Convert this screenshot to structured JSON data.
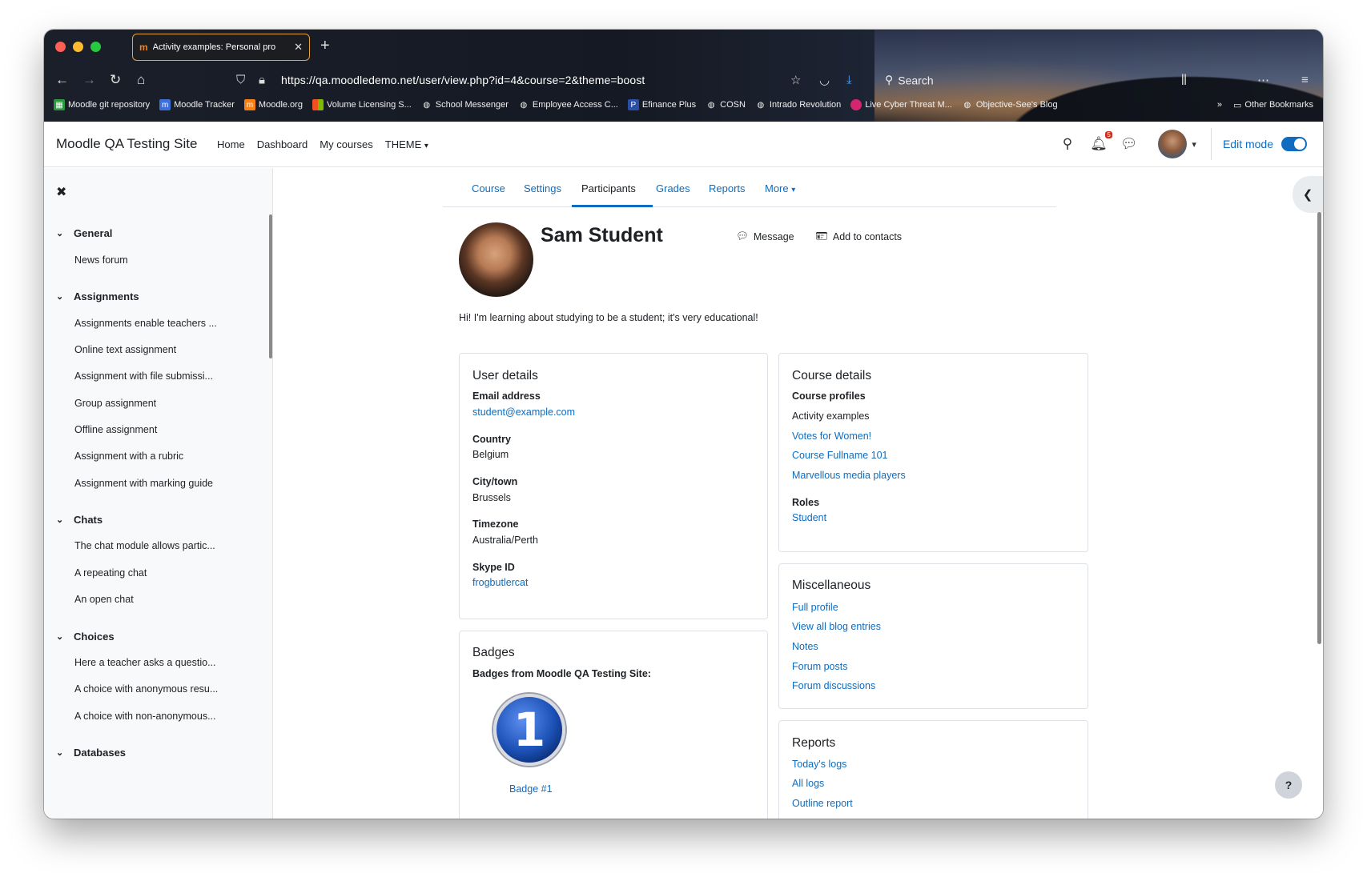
{
  "browser": {
    "tab_title": "Activity examples: Personal pro",
    "tab_favicon": "m",
    "url": "https://qa.moodledemo.net/user/view.php?id=4&course=2&theme=boost",
    "search_label": "Search",
    "bookmarks": [
      {
        "label": "Moodle git repository",
        "icon": "grid-icon"
      },
      {
        "label": "Moodle Tracker",
        "icon": "moodle-icon"
      },
      {
        "label": "Moodle.org",
        "icon": "moodle-icon"
      },
      {
        "label": "Volume Licensing S...",
        "icon": "windows-icon"
      },
      {
        "label": "School Messenger",
        "icon": "globe-icon"
      },
      {
        "label": "Employee Access C...",
        "icon": "globe-icon"
      },
      {
        "label": "Efinance Plus",
        "icon": "p-icon"
      },
      {
        "label": "COSN",
        "icon": "globe-icon"
      },
      {
        "label": "Intrado Revolution",
        "icon": "globe-icon"
      },
      {
        "label": "Live Cyber Threat M...",
        "icon": "cyber-icon"
      },
      {
        "label": "Objective-See's Blog",
        "icon": "globe-icon"
      }
    ],
    "other_bookmarks": "Other Bookmarks"
  },
  "header": {
    "site_name": "Moodle QA Testing Site",
    "nav": [
      "Home",
      "Dashboard",
      "My courses",
      "THEME"
    ],
    "notification_count": "5",
    "edit_mode_label": "Edit mode"
  },
  "drawer": {
    "sections": [
      {
        "title": "General",
        "items": [
          "News forum"
        ]
      },
      {
        "title": "Assignments",
        "items": [
          "Assignments enable teachers ...",
          "Online text assignment",
          "Assignment with file submissi...",
          "Group assignment",
          "Offline assignment",
          "Assignment with a rubric",
          "Assignment with marking guide"
        ]
      },
      {
        "title": "Chats",
        "items": [
          "The chat module allows partic...",
          "A repeating chat",
          "An open chat"
        ]
      },
      {
        "title": "Choices",
        "items": [
          "Here a teacher asks a questio...",
          "A choice with anonymous resu...",
          "A choice with non-anonymous..."
        ]
      },
      {
        "title": "Databases",
        "items": []
      }
    ]
  },
  "secondary_nav": {
    "tabs": [
      "Course",
      "Settings",
      "Participants",
      "Grades",
      "Reports",
      "More"
    ],
    "active": "Participants"
  },
  "profile": {
    "name": "Sam Student",
    "message_label": "Message",
    "add_contact_label": "Add to contacts",
    "bio": "Hi! I'm learning about studying to be a student; it's very educational!"
  },
  "user_details": {
    "title": "User details",
    "email_label": "Email address",
    "email": "student@example.com",
    "country_label": "Country",
    "country": "Belgium",
    "city_label": "City/town",
    "city": "Brussels",
    "timezone_label": "Timezone",
    "timezone": "Australia/Perth",
    "skype_label": "Skype ID",
    "skype": "frogbutlercat"
  },
  "badges": {
    "title": "Badges",
    "subtitle": "Badges from Moodle QA Testing Site:",
    "badge_number": "1",
    "badge_name": "Badge #1"
  },
  "course_details": {
    "title": "Course details",
    "profiles_label": "Course profiles",
    "current_course": "Activity examples",
    "courses": [
      "Votes for Women!",
      "Course Fullname 101",
      "Marvellous media players"
    ],
    "roles_label": "Roles",
    "role": "Student"
  },
  "misc": {
    "title": "Miscellaneous",
    "links": [
      "Full profile",
      "View all blog entries",
      "Notes",
      "Forum posts",
      "Forum discussions"
    ]
  },
  "reports": {
    "title": "Reports",
    "links": [
      "Today's logs",
      "All logs",
      "Outline report"
    ]
  },
  "help_label": "?",
  "colors": {
    "link": "#0f6cbf",
    "text": "#1d2125",
    "accent": "#f98012"
  }
}
